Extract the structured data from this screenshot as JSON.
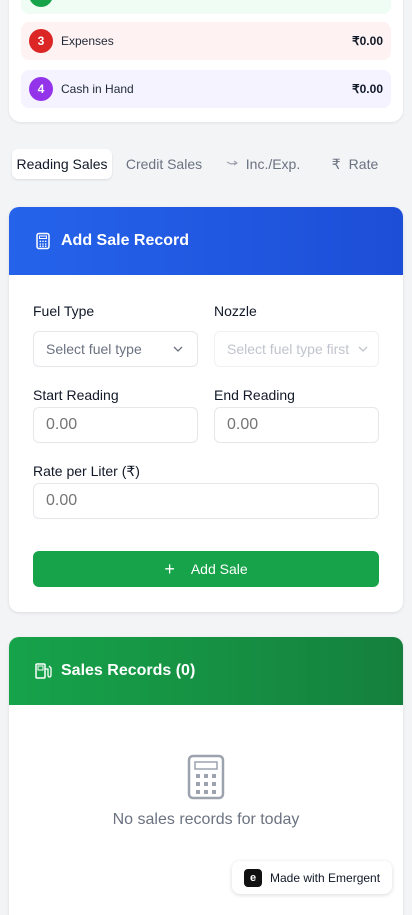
{
  "summary": {
    "rows": [
      {
        "num": "",
        "label": "",
        "value": ""
      },
      {
        "num": "3",
        "label": "Expenses",
        "value": "₹0.00"
      },
      {
        "num": "4",
        "label": "Cash in Hand",
        "value": "₹0.00"
      }
    ]
  },
  "tabs": [
    {
      "label": "Reading Sales",
      "icon": ""
    },
    {
      "label": "Credit Sales",
      "icon": ""
    },
    {
      "label": "Inc./Exp.",
      "icon": "trend-icon"
    },
    {
      "label": "Rate",
      "icon": "rupee-icon"
    }
  ],
  "add_sale": {
    "title": "Add Sale Record",
    "fuel_type_label": "Fuel Type",
    "fuel_type_placeholder": "Select fuel type",
    "nozzle_label": "Nozzle",
    "nozzle_placeholder": "Select fuel type first",
    "start_label": "Start Reading",
    "start_placeholder": "0.00",
    "end_label": "End Reading",
    "end_placeholder": "0.00",
    "rate_label": "Rate per Liter (₹)",
    "rate_placeholder": "0.00",
    "button": "Add Sale"
  },
  "records": {
    "title": "Sales Records (0)",
    "empty": "No sales records for today"
  },
  "badge": {
    "text": "Made with Emergent"
  }
}
